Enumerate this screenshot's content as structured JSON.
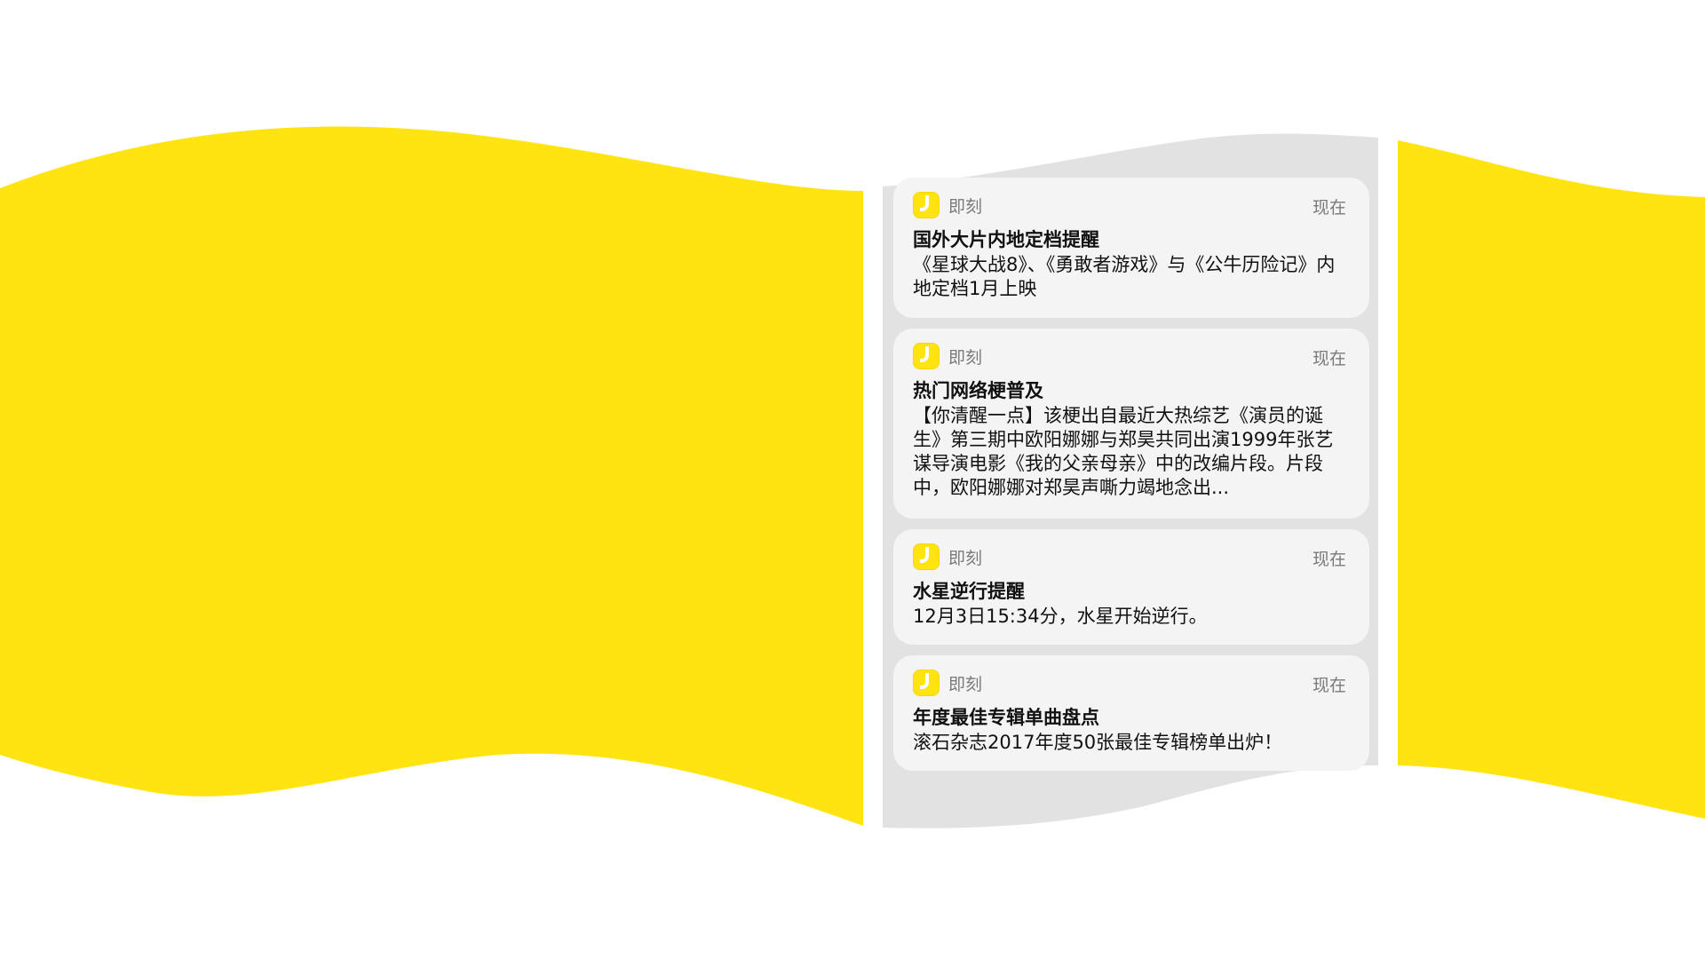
{
  "colors": {
    "accent_yellow": "#ffe411",
    "panel_gray": "#e2e2e2",
    "card_bg": "#f4f4f4",
    "secondary_text": "#7a7a7a"
  },
  "notifications": [
    {
      "app_icon": "jike-app-icon",
      "app_name": "即刻",
      "time": "现在",
      "title": "国外大片内地定档提醒",
      "body": "《星球大战8》、《勇敢者游戏》与《公牛历险记》内地定档1月上映"
    },
    {
      "app_icon": "jike-app-icon",
      "app_name": "即刻",
      "time": "现在",
      "title": "热门网络梗普及",
      "body": "【你清醒一点】该梗出自最近大热综艺《演员的诞生》第三期中欧阳娜娜与郑昊共同出演1999年张艺谋导演电影《我的父亲母亲》中的改编片段。片段中，欧阳娜娜对郑昊声嘶力竭地念出..."
    },
    {
      "app_icon": "jike-app-icon",
      "app_name": "即刻",
      "time": "现在",
      "title": "水星逆行提醒",
      "body": "12月3日15:34分，水星开始逆行。"
    },
    {
      "app_icon": "jike-app-icon",
      "app_name": "即刻",
      "time": "现在",
      "title": "年度最佳专辑单曲盘点",
      "body": "滚石杂志2017年度50张最佳专辑榜单出炉！"
    }
  ]
}
